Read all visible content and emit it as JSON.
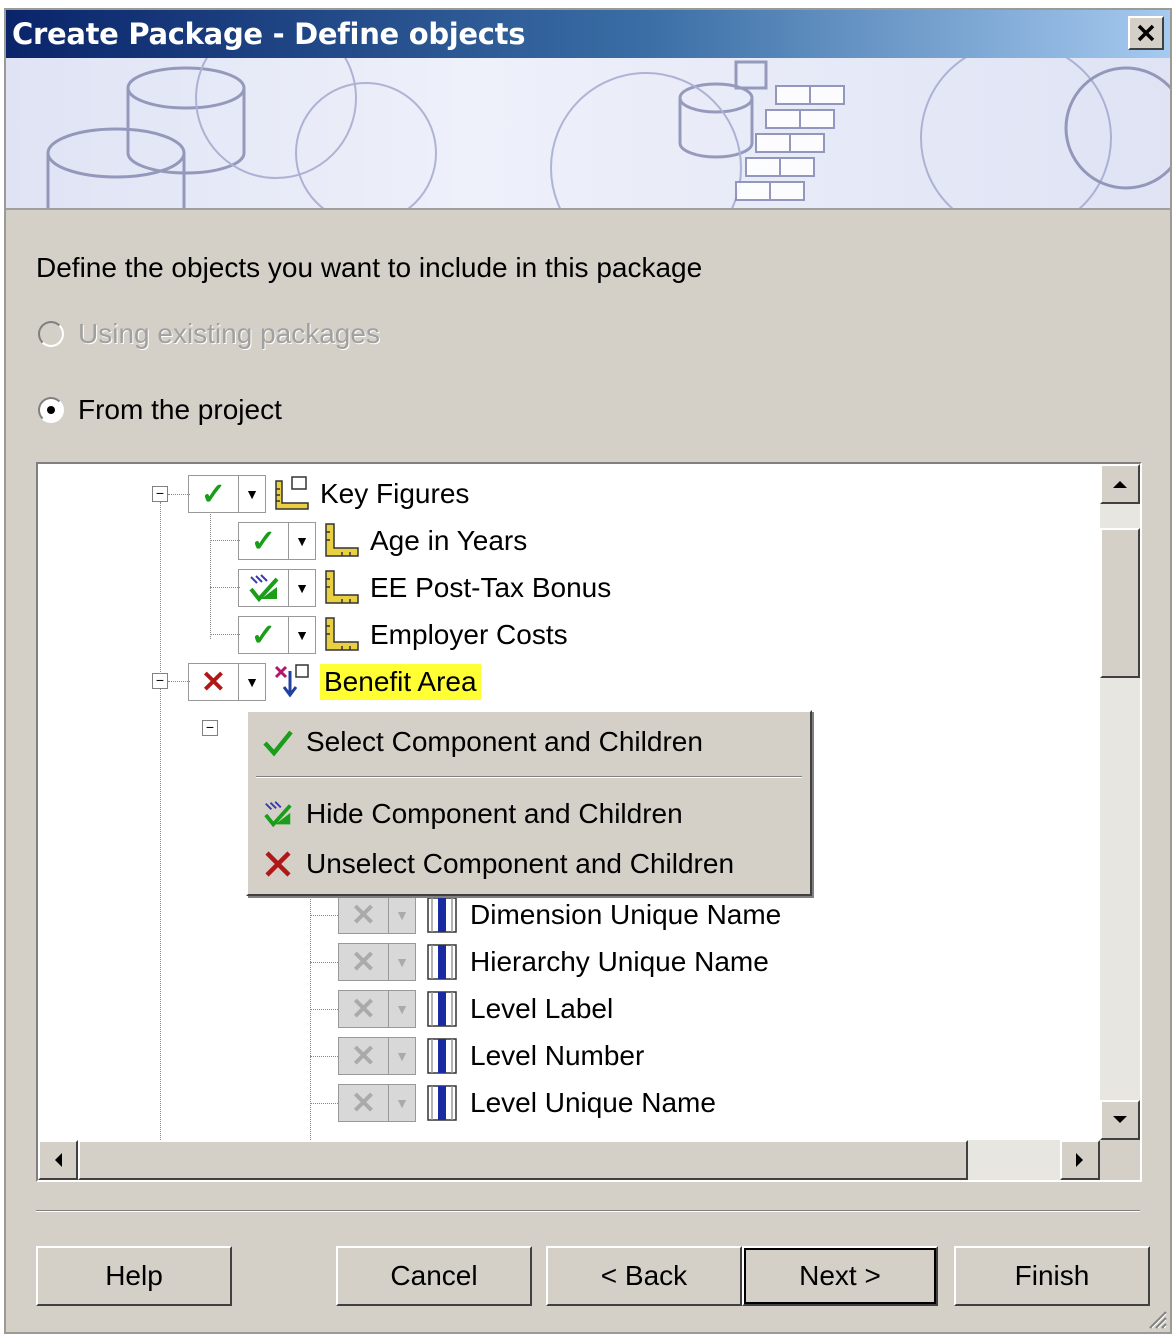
{
  "window": {
    "title": "Create Package - Define objects",
    "close_label": "×"
  },
  "instruction": "Define the objects you want to include in this package",
  "options": {
    "existing_label": "Using existing packages",
    "existing_selected": false,
    "existing_enabled": false,
    "project_label": "From the project",
    "project_selected": true
  },
  "tree": {
    "nodes": [
      {
        "label": "Key Figures",
        "state": "selected",
        "icon": "key-figures-folder-icon"
      },
      {
        "label": "Age in Years",
        "state": "selected",
        "icon": "measure-ruler-icon"
      },
      {
        "label": "EE Post-Tax Bonus",
        "state": "hidden",
        "icon": "measure-ruler-icon"
      },
      {
        "label": "Employer Costs",
        "state": "selected",
        "icon": "measure-ruler-icon"
      },
      {
        "label": "Benefit Area",
        "state": "unselected",
        "icon": "dimension-icon",
        "highlighted": true
      },
      {
        "label": "Dimension Unique Name",
        "state": "disabled",
        "icon": "attribute-bar-icon"
      },
      {
        "label": "Hierarchy Unique Name",
        "state": "disabled",
        "icon": "attribute-bar-icon"
      },
      {
        "label": "Level Label",
        "state": "disabled",
        "icon": "attribute-bar-icon"
      },
      {
        "label": "Level Number",
        "state": "disabled",
        "icon": "attribute-bar-icon"
      },
      {
        "label": "Level Unique Name",
        "state": "disabled",
        "icon": "attribute-bar-icon"
      }
    ]
  },
  "context_menu": {
    "items": [
      {
        "label": "Select Component and Children",
        "icon": "check-icon"
      },
      {
        "label": "Hide Component and Children",
        "icon": "hide-check-icon"
      },
      {
        "label": "Unselect Component and Children",
        "icon": "x-icon"
      }
    ]
  },
  "buttons": {
    "help": "Help",
    "cancel": "Cancel",
    "back": "< Back",
    "next": "Next >",
    "finish": "Finish"
  },
  "colors": {
    "check_green": "#1a9e1a",
    "x_red": "#b01818",
    "highlight_yellow": "#ffff33",
    "title_blue": "#0a246a"
  }
}
